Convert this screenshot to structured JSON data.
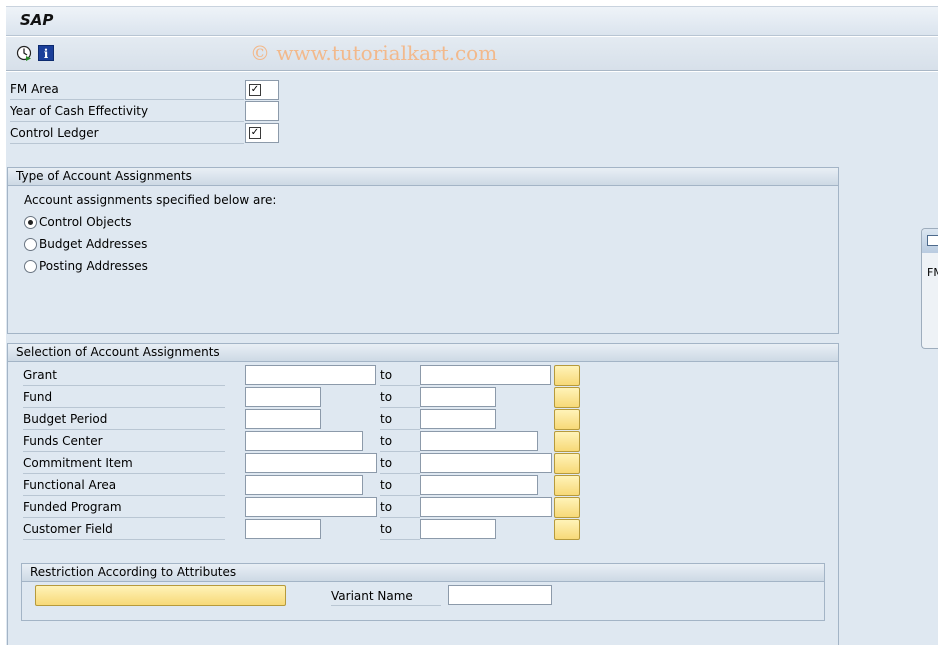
{
  "window": {
    "title": "SAP",
    "watermark": "© www.tutorialkart.com"
  },
  "toolbar": {
    "icons": [
      "clock-execute-icon",
      "info-icon"
    ],
    "info_glyph": "i"
  },
  "params": {
    "fm_area_label": "FM Area",
    "fm_area_checked": true,
    "year_label": "Year of Cash Effectivity",
    "year_value": "",
    "control_ledger_label": "Control Ledger",
    "control_ledger_checked": true
  },
  "type_group": {
    "title": "Type of Account Assignments",
    "prompt": "Account assignments specified below are:",
    "options": [
      {
        "label": "Control Objects",
        "selected": true
      },
      {
        "label": "Budget Addresses",
        "selected": false
      },
      {
        "label": "Posting Addresses",
        "selected": false
      }
    ]
  },
  "selection_group": {
    "title": "Selection of Account Assignments",
    "to_label": "to",
    "rows": [
      {
        "label": "Grant",
        "from": "",
        "to": ""
      },
      {
        "label": "Fund",
        "from": "",
        "to": ""
      },
      {
        "label": "Budget Period",
        "from": "",
        "to": ""
      },
      {
        "label": "Funds Center",
        "from": "",
        "to": ""
      },
      {
        "label": "Commitment Item",
        "from": "",
        "to": ""
      },
      {
        "label": "Functional Area",
        "from": "",
        "to": ""
      },
      {
        "label": "Funded Program",
        "from": "",
        "to": ""
      },
      {
        "label": "Customer Field",
        "from": "",
        "to": ""
      }
    ]
  },
  "attributes_group": {
    "title": "Restriction According to Attributes",
    "variant_label": "Variant Name",
    "variant_value": ""
  },
  "side_panel": {
    "text": "FM"
  },
  "colors": {
    "background": "#dfe8f1",
    "multi_button": "#f7d978",
    "border": "#a3b4c6"
  }
}
